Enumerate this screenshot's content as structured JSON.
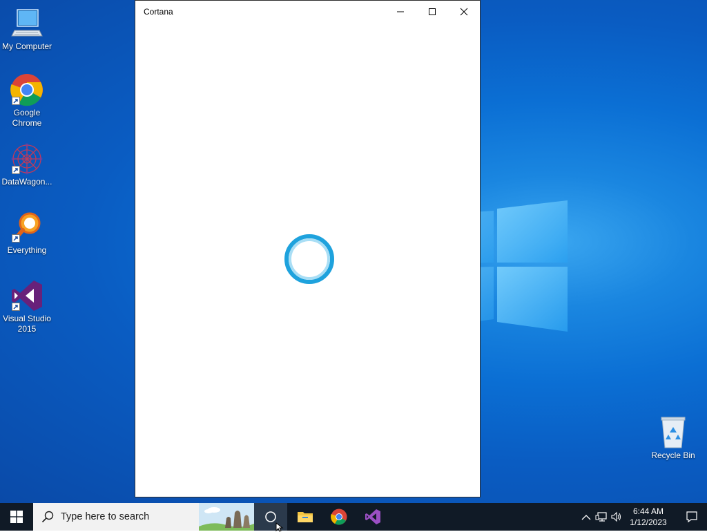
{
  "desktop": {
    "icons": [
      {
        "label": "My Computer",
        "icon": "computer-icon"
      },
      {
        "label": "Google Chrome",
        "icon": "chrome-icon"
      },
      {
        "label": "DataWagon...",
        "icon": "datawagon-icon"
      },
      {
        "label": "Everything",
        "icon": "everything-search-icon"
      },
      {
        "label": "Visual Studio 2015",
        "icon": "visual-studio-icon"
      },
      {
        "label": "Recycle Bin",
        "icon": "recycle-bin-icon"
      }
    ]
  },
  "window": {
    "title": "Cortana",
    "buttons": [
      "minimize",
      "maximize",
      "close"
    ],
    "accent": "#2aa7e0"
  },
  "taskbar": {
    "search_placeholder": "Type here to search",
    "pinned": [
      "cortana",
      "file-explorer",
      "google-chrome",
      "visual-studio"
    ],
    "clock": {
      "time": "6:44 AM",
      "date": "1/12/2023"
    },
    "background": "#101a26"
  }
}
